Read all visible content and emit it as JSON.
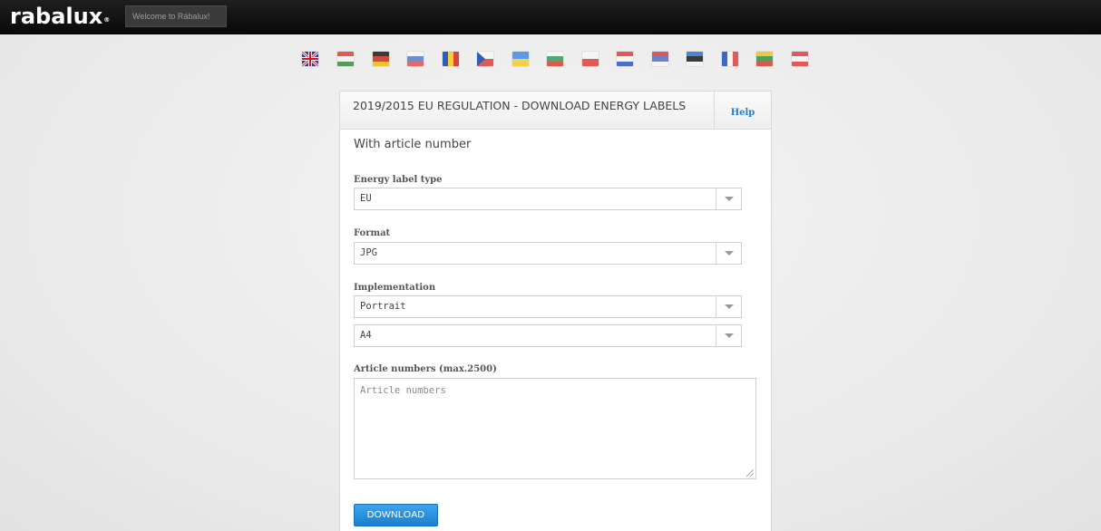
{
  "header": {
    "logo_text": "rabalux",
    "logo_mark": "®",
    "welcome": "Welcome to Rábalux!"
  },
  "languages": [
    {
      "icon": "flag-uk-icon",
      "colors": [
        "#2a3f8f",
        "#ffffff",
        "#cf142b"
      ]
    },
    {
      "icon": "flag-hu-icon",
      "colors": [
        "#e35b4a",
        "#f2f2f2",
        "#5a9a58"
      ]
    },
    {
      "icon": "flag-de-icon",
      "colors": [
        "#3a3a3a",
        "#d34a3a",
        "#f1c132"
      ]
    },
    {
      "icon": "flag-sk-icon",
      "colors": [
        "#f4f4f4",
        "#6a8ed6",
        "#e36a6a"
      ]
    },
    {
      "icon": "flag-ro-icon",
      "colors": [
        "#2f5db6",
        "#f4cf3a",
        "#d8453a"
      ]
    },
    {
      "icon": "flag-cz-icon",
      "colors": [
        "#f4f4f4",
        "#e05a5a",
        "#2f5db6"
      ]
    },
    {
      "icon": "flag-ua-icon",
      "colors": [
        "#5b9ae6",
        "#f3d24a"
      ]
    },
    {
      "icon": "flag-bg-icon",
      "colors": [
        "#f4f4f4",
        "#4fa874",
        "#e05a4a"
      ]
    },
    {
      "icon": "flag-pl-icon",
      "colors": [
        "#f4f4f4",
        "#e45858"
      ]
    },
    {
      "icon": "flag-hr-icon",
      "colors": [
        "#e05858",
        "#f4f4f4",
        "#4a6fc2"
      ]
    },
    {
      "icon": "flag-rs-icon",
      "colors": [
        "#d85a5a",
        "#6a82c8",
        "#f4f4f4"
      ]
    },
    {
      "icon": "flag-ee-icon",
      "colors": [
        "#4a85d6",
        "#3a3a3a",
        "#f4f4f4"
      ]
    },
    {
      "icon": "flag-fr-icon",
      "colors": [
        "#3f68c6",
        "#f4f4f4",
        "#e05a5a"
      ]
    },
    {
      "icon": "flag-lt-icon",
      "colors": [
        "#f4c63a",
        "#4fa05a",
        "#d85a4a"
      ]
    },
    {
      "icon": "flag-at-icon",
      "colors": [
        "#e05a5a",
        "#f4f4f4",
        "#e05a5a"
      ]
    }
  ],
  "panel": {
    "title": "2019/2015 EU REGULATION - DOWNLOAD ENERGY LABELS",
    "help_label": "Help",
    "section_title": "With article number",
    "energy_label_type": {
      "label": "Energy label type",
      "value": "EU"
    },
    "format": {
      "label": "Format",
      "value": "JPG"
    },
    "implementation": {
      "label": "Implementation",
      "orientation": "Portrait",
      "size": "A4"
    },
    "article_numbers": {
      "label": "Article numbers (max.2500)",
      "placeholder": "Article numbers"
    },
    "download_label": "DOWNLOAD"
  },
  "colors": {
    "accent": "#2b7bc4",
    "button": "#1a7fd0",
    "topbar": "#0d0d0d"
  }
}
